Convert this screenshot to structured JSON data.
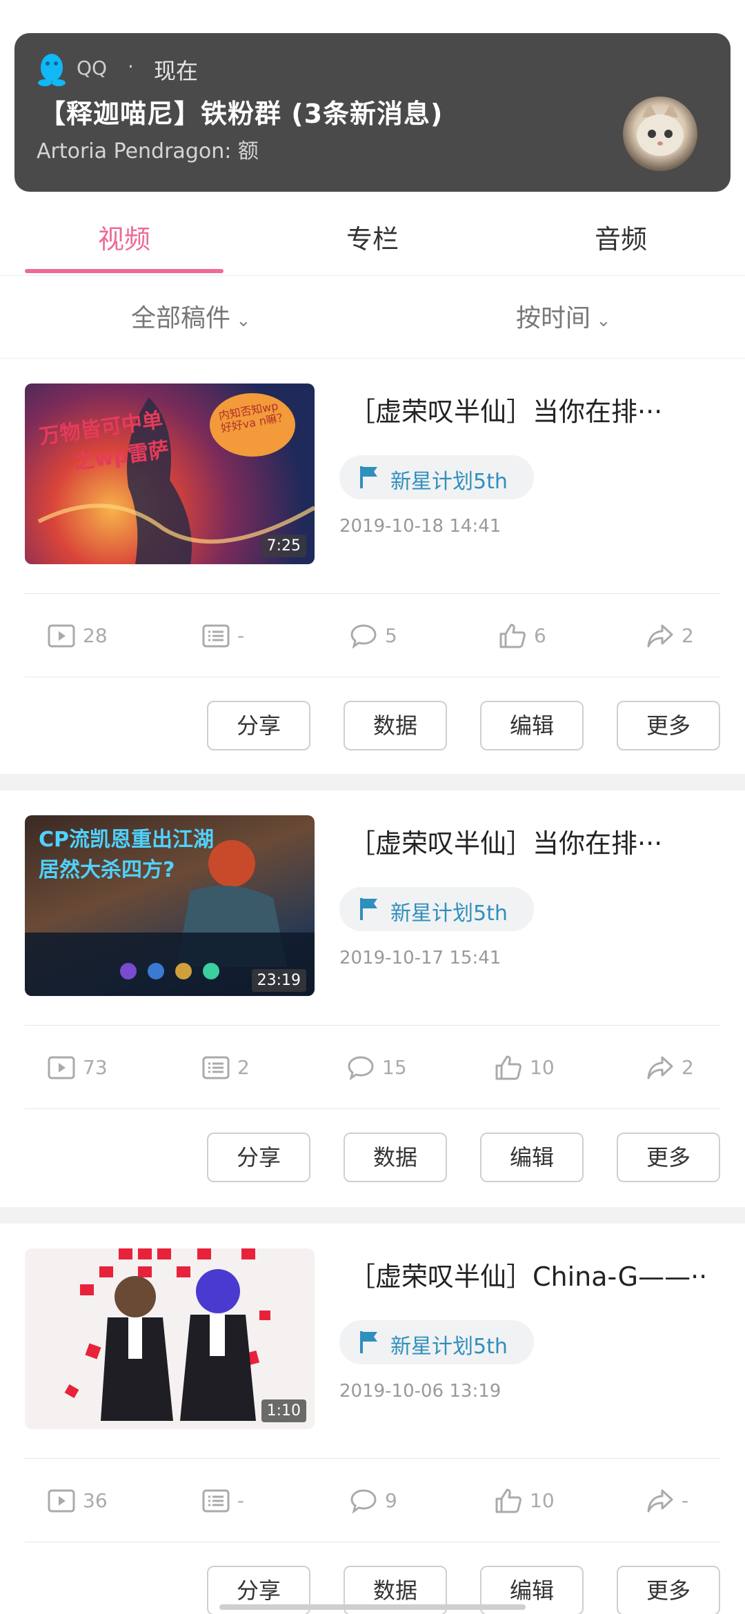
{
  "notification": {
    "app": "QQ",
    "dot": "·",
    "time": "现在",
    "title": "【释迦喵尼】铁粉群 (3条新消息)",
    "message": "Artoria Pendragon: 额"
  },
  "tabs": [
    {
      "label": "视频",
      "active": true
    },
    {
      "label": "专栏",
      "active": false
    },
    {
      "label": "音频",
      "active": false
    }
  ],
  "filters": {
    "all": "全部稿件",
    "sort": "按时间"
  },
  "videos": [
    {
      "title": "［虚荣叹半仙］当你在排···",
      "badge": "新星计划5th",
      "date": "2019-10-18  14:41",
      "duration": "7:25",
      "thumb_text_1": "万物皆可中单",
      "thumb_text_2": "之wp雷萨",
      "thumb_bubble": "内知否知wp好好va n嘛？",
      "stats": {
        "plays": "28",
        "danmaku": "-",
        "comments": "5",
        "likes": "6",
        "shares": "2"
      }
    },
    {
      "title": "［虚荣叹半仙］当你在排···",
      "badge": "新星计划5th",
      "date": "2019-10-17  15:41",
      "duration": "23:19",
      "thumb_text_1": "CP流凯恩重出江湖",
      "thumb_text_2": "居然大杀四方?",
      "stats": {
        "plays": "73",
        "danmaku": "2",
        "comments": "15",
        "likes": "10",
        "shares": "2"
      }
    },
    {
      "title": "［虚荣叹半仙］China-G——···",
      "badge": "新星计划5th",
      "date": "2019-10-06  13:19",
      "duration": "1:10",
      "stats": {
        "plays": "36",
        "danmaku": "-",
        "comments": "9",
        "likes": "10",
        "shares": "-"
      }
    }
  ],
  "actions": {
    "share": "分享",
    "data": "数据",
    "edit": "编辑",
    "more": "更多"
  },
  "colors": {
    "accent": "#ee6a94",
    "badge_text": "#2f8fbd",
    "notification_bg": "#4a4a4a"
  }
}
